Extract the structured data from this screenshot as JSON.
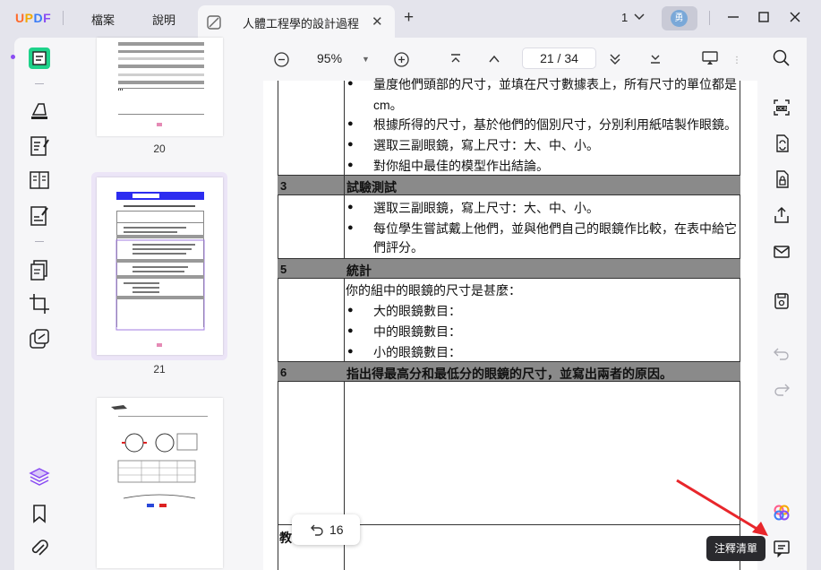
{
  "app": {
    "logo": "UPDF"
  },
  "menu": {
    "file": "檔案",
    "help": "說明"
  },
  "tab": {
    "title": "人體工程學的設計過程"
  },
  "titlebar": {
    "page_counter": "1",
    "avatar_initial": "勇"
  },
  "view": {
    "zoom": "95%",
    "current_page": "21",
    "total_pages": "34",
    "page_sep": "/"
  },
  "thumbnails": [
    {
      "label": "20"
    },
    {
      "label": "21",
      "selected": true
    },
    {
      "label": ""
    }
  ],
  "document": {
    "lines_top": [
      "量度他們頭部的尺寸，並填在尺寸數據表上，所有尺寸的單位都是",
      "cm。",
      "根據所得的尺寸，基於他們的個別尺寸，分別利用紙咭製作眼鏡。",
      "選取三副眼鏡，寫上尺寸：大、中、小。",
      "對你組中最佳的模型作出結論。"
    ],
    "sections": [
      {
        "num": "3",
        "title": "試驗測試"
      },
      {
        "num": "5",
        "title": "統計"
      },
      {
        "num": "6",
        "title": "指出得最高分和最低分的眼鏡的尺寸，並寫出兩者的原因。"
      }
    ],
    "sec3_lines": [
      "選取三副眼鏡，寫上尺寸：大、中、小。",
      "每位學生嘗試戴上他們，並與他們自己的眼鏡作比較，在表中給它",
      "們評分。"
    ],
    "sec5_intro": "你的組中的眼鏡的尺寸是甚麼：",
    "sec5_lines": [
      "大的眼鏡數目：",
      "中的眼鏡數目：",
      "小的眼鏡數目："
    ],
    "footer_partial": "教"
  },
  "undo_popup": {
    "count": "16"
  },
  "tooltip": {
    "text": "注釋清單"
  },
  "colors": {
    "accent": "#8a4cf3",
    "band": "#8a8a8a",
    "arrow": "#e8262b"
  }
}
